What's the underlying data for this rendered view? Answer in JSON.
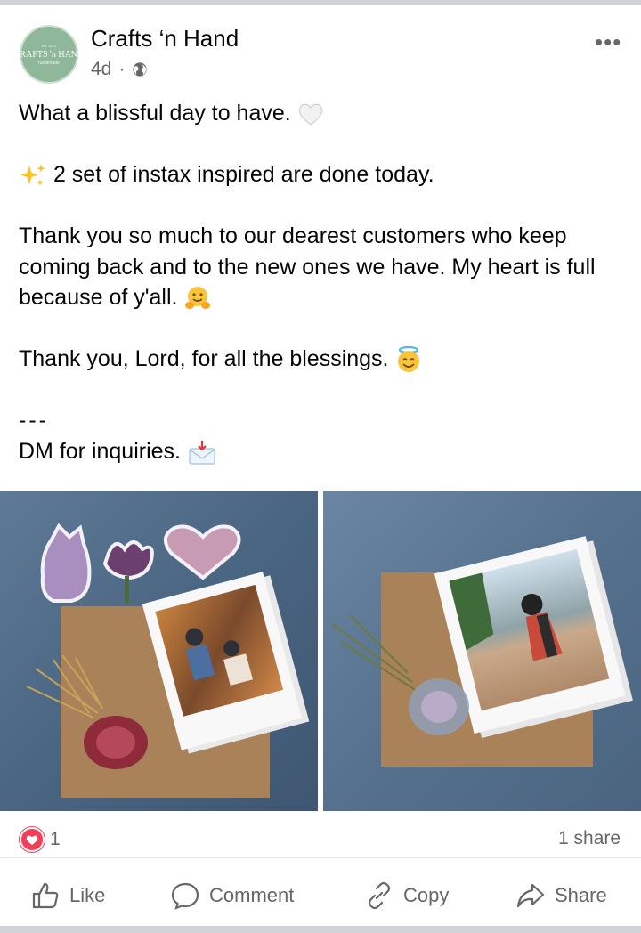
{
  "post": {
    "page_name": "Crafts ‘n Hand",
    "avatar_text": "CRAFTS 'n HAND",
    "time": "4d",
    "separator": "·",
    "privacy_icon": "globe-icon",
    "menu_icon": "more-horizontal-icon",
    "text_lines": [
      "What a blissful day to have.",
      "2 set of instax inspired are done today.",
      "Thank you so much to our dearest customers who keep coming back and to the new ones we have. My heart is full because of y'all.",
      "Thank you, Lord, for all the blessings.",
      "---",
      "DM for inquiries."
    ],
    "emojis": [
      "white-heart",
      "sparkles",
      "hugging-face",
      "smiling-face-with-halo",
      "envelope-with-arrow"
    ]
  },
  "photos": [
    {
      "name": "instax-set-1"
    },
    {
      "name": "instax-set-2"
    }
  ],
  "stats": {
    "reaction_icon": "heart-reaction-icon",
    "reaction_count": "1",
    "shares": "1 share"
  },
  "actions": {
    "like": "Like",
    "comment": "Comment",
    "copy": "Copy",
    "share": "Share"
  },
  "colors": {
    "reaction_red": "#f33e58",
    "muted_text": "#65676b",
    "denim": "#4e6a87",
    "kraft": "#a9825a"
  }
}
